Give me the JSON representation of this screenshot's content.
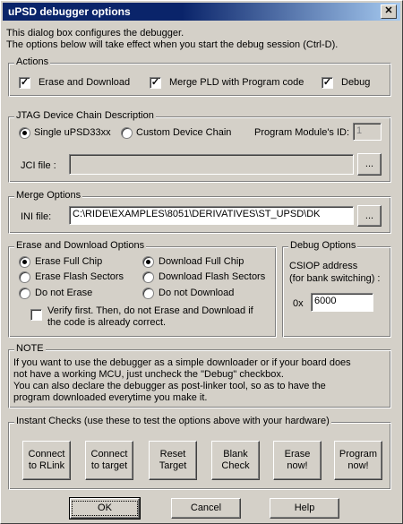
{
  "window": {
    "title": "uPSD debugger options",
    "close_glyph": "✕"
  },
  "intro": {
    "line1": "This dialog box configures the debugger.",
    "line2": "The options below will take effect when you start the debug session (Ctrl-D)."
  },
  "actions": {
    "legend": "Actions",
    "erase_download": {
      "label": "Erase and Download",
      "checked": true
    },
    "merge_pld": {
      "label": "Merge PLD with Program code",
      "checked": true
    },
    "debug": {
      "label": "Debug",
      "checked": true
    }
  },
  "jtag": {
    "legend": "JTAG Device Chain Description",
    "single_label": "Single uPSD33xx",
    "custom_label": "Custom Device Chain",
    "selected": "single",
    "module_id_label": "Program Module's ID:",
    "module_id_value": "1",
    "jci_label": "JCI file :",
    "jci_value": "",
    "browse_label": "..."
  },
  "merge": {
    "legend": "Merge Options",
    "ini_label": "INI file:",
    "ini_value": "C:\\RIDE\\EXAMPLES\\8051\\DERIVATIVES\\ST_UPSD\\DK",
    "browse_label": "..."
  },
  "erase_download": {
    "legend": "Erase and Download Options",
    "erase_full": "Erase Full Chip",
    "erase_flash": "Erase Flash Sectors",
    "do_not_erase": "Do not Erase",
    "download_full": "Download Full Chip",
    "download_flash": "Download Flash Sectors",
    "do_not_download": "Do not Download",
    "erase_selected": "full",
    "download_selected": "full",
    "verify_line1": "Verify first. Then, do not Erase and Download if",
    "verify_line2": "the code is already correct.",
    "verify_checked": false
  },
  "debug_options": {
    "legend": "Debug Options",
    "csiop_label": "CSIOP address",
    "csiop_sub": "(for bank switching) :",
    "prefix": "0x",
    "value": "6000"
  },
  "note": {
    "legend": "NOTE",
    "line1": "If you want to use the debugger as a simple downloader or if your board does",
    "line2": "not have a working MCU, just uncheck the \"Debug\" checkbox.",
    "line3": "You can also declare the debugger as post-linker tool, so as to have the",
    "line4": "program downloaded everytime you make it."
  },
  "instant": {
    "legend": "Instant Checks (use these to test the options above with your hardware)",
    "buttons": [
      {
        "line1": "Connect",
        "line2": "to RLink"
      },
      {
        "line1": "Connect",
        "line2": "to target"
      },
      {
        "line1": "Reset",
        "line2": "Target"
      },
      {
        "line1": "Blank",
        "line2": "Check"
      },
      {
        "line1": "Erase",
        "line2": "now!"
      },
      {
        "line1": "Program",
        "line2": "now!"
      }
    ]
  },
  "footer": {
    "ok": "OK",
    "cancel": "Cancel",
    "help": "Help"
  }
}
